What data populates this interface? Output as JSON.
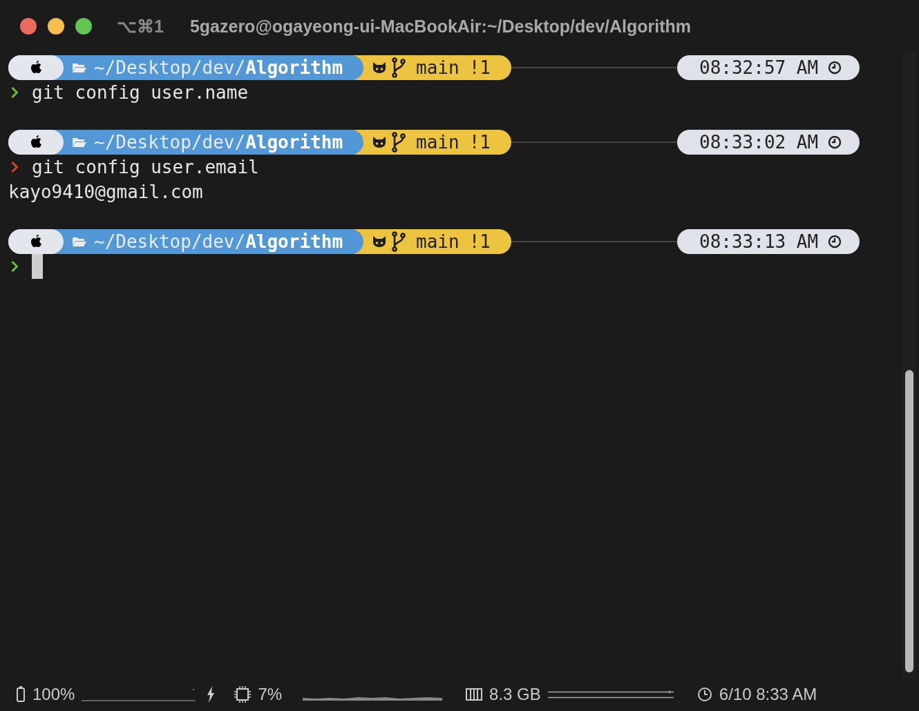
{
  "window": {
    "shortcut": "⌥⌘1",
    "title": "5gazero@ogayeong-ui-MacBookAir:~/Desktop/dev/Algorithm"
  },
  "blocks": [
    {
      "path": "~/Desktop/dev/**Algorithm**",
      "branch": "main",
      "git_status": "!1",
      "time": "08:32:57 AM",
      "success": true,
      "command": "git config user.name",
      "cursor": false
    },
    {
      "path": "~/Desktop/dev/**Algorithm**",
      "branch": "main",
      "git_status": "!1",
      "time": "08:33:02 AM",
      "success": false,
      "command": "git config user.email",
      "output": [
        "kayo9410@gmail.com"
      ],
      "cursor": false
    },
    {
      "path": "~/Desktop/dev/**Algorithm**",
      "branch": "main",
      "git_status": "!1",
      "time": "08:33:13 AM",
      "success": true,
      "cursor": true
    }
  ],
  "status_bar": {
    "battery": "100%",
    "cpu": "7%",
    "memory": "8.3 GB",
    "datetime": "6/10 8:33 AM"
  }
}
